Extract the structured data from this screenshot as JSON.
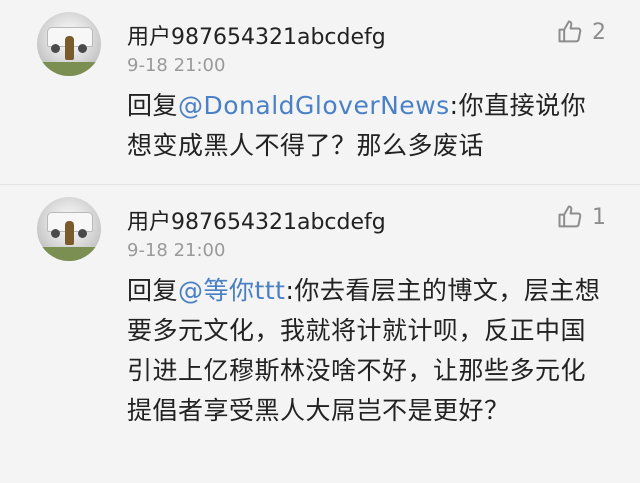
{
  "comments": [
    {
      "username": "用户987654321abcdefg",
      "time": "9-18 21:00",
      "likes": "2",
      "reply_prefix": "回复",
      "mention": "@DonaldGloverNews",
      "text": ":你直接说你想变成黑人不得了？那么多废话"
    },
    {
      "username": "用户987654321abcdefg",
      "time": "9-18 21:00",
      "likes": "1",
      "reply_prefix": "回复",
      "mention": "@等你ttt",
      "text": ":你去看层主的博文，层主想要多元文化，我就将计就计呗，反正中国引进上亿穆斯林没啥不好，让那些多元化提倡者享受黑人大屌岂不是更好？"
    }
  ],
  "icons": {
    "like": "thumbs-up-icon",
    "avatar": "avatar-car-photo"
  },
  "colors": {
    "mention": "#4a80c5",
    "meta": "#9a9a9a",
    "text": "#222222",
    "background": "#f4f4f4"
  }
}
